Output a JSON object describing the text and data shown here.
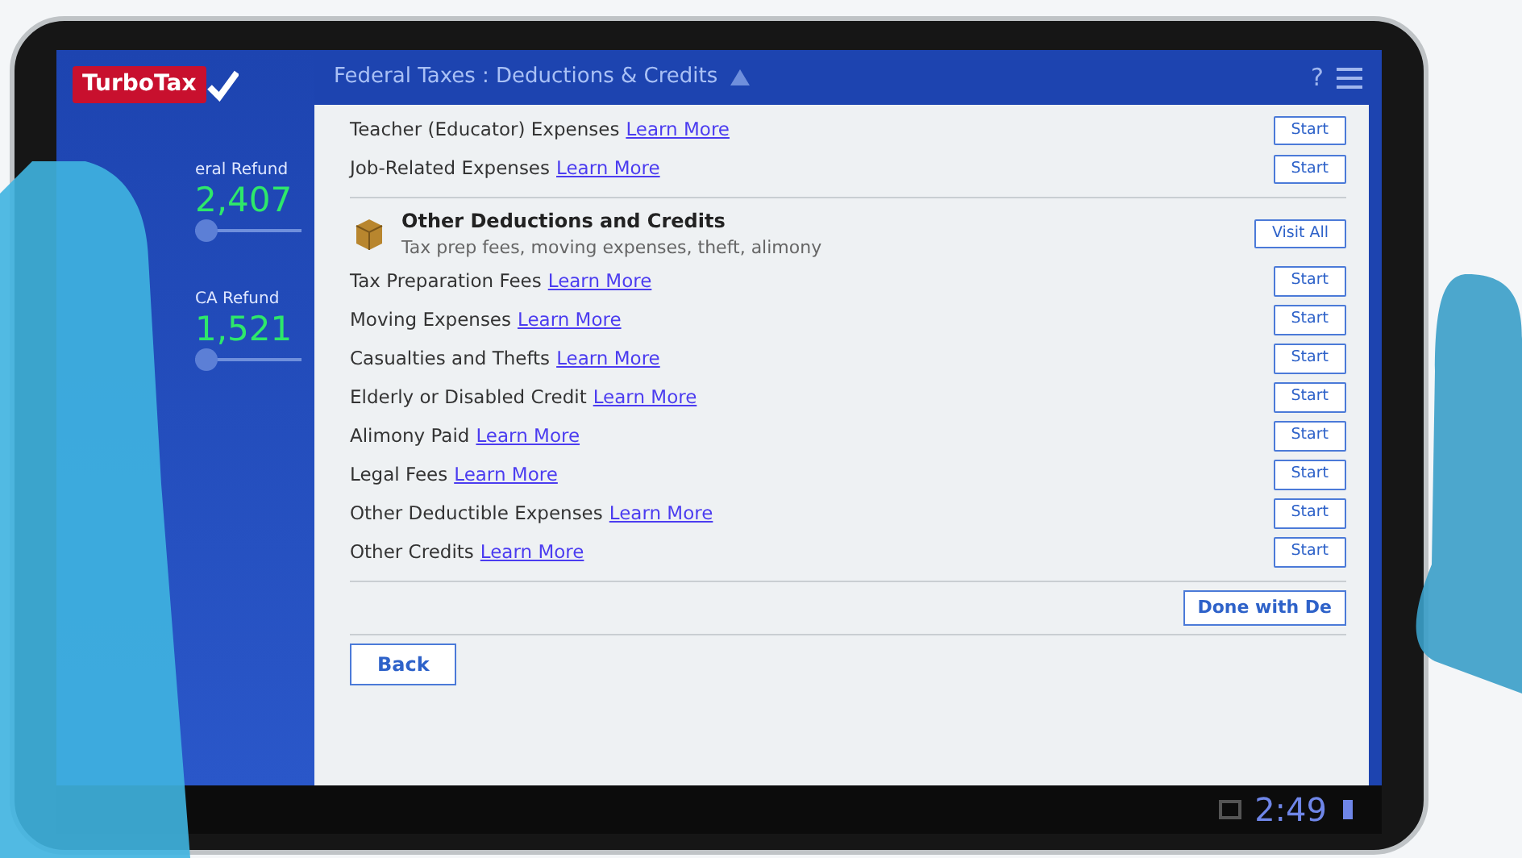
{
  "header": {
    "title": "Federal Taxes : Deductions & Credits",
    "help": "?"
  },
  "sidebar": {
    "logo": "TurboTax",
    "refunds": [
      {
        "label": "eral Refund",
        "amount": "2,407"
      },
      {
        "label": "CA Refund",
        "amount": "1,521"
      }
    ]
  },
  "items": [
    {
      "label": "Teacher (Educator) Expenses",
      "link": "Learn More",
      "button": "Start"
    },
    {
      "label": "Job-Related Expenses",
      "link": "Learn More",
      "button": "Start"
    }
  ],
  "group": {
    "title": "Other Deductions and Credits",
    "subtitle": "Tax prep fees, moving expenses, theft, alimony",
    "action": "Visit All",
    "items": [
      {
        "label": "Tax Preparation Fees",
        "link": "Learn More",
        "button": "Start"
      },
      {
        "label": "Moving Expenses",
        "link": "Learn More",
        "button": "Start"
      },
      {
        "label": "Casualties and Thefts",
        "link": "Learn More",
        "button": "Start"
      },
      {
        "label": "Elderly or Disabled Credit",
        "link": "Learn More",
        "button": "Start"
      },
      {
        "label": "Alimony Paid",
        "link": "Learn More",
        "button": "Start"
      },
      {
        "label": "Legal Fees",
        "link": "Learn More",
        "button": "Start"
      },
      {
        "label": "Other Deductible Expenses",
        "link": "Learn More",
        "button": "Start"
      },
      {
        "label": "Other Credits",
        "link": "Learn More",
        "button": "Start"
      }
    ]
  },
  "done_button": "Done with De",
  "back_button": "Back",
  "status_bar": {
    "time": "2:49"
  }
}
